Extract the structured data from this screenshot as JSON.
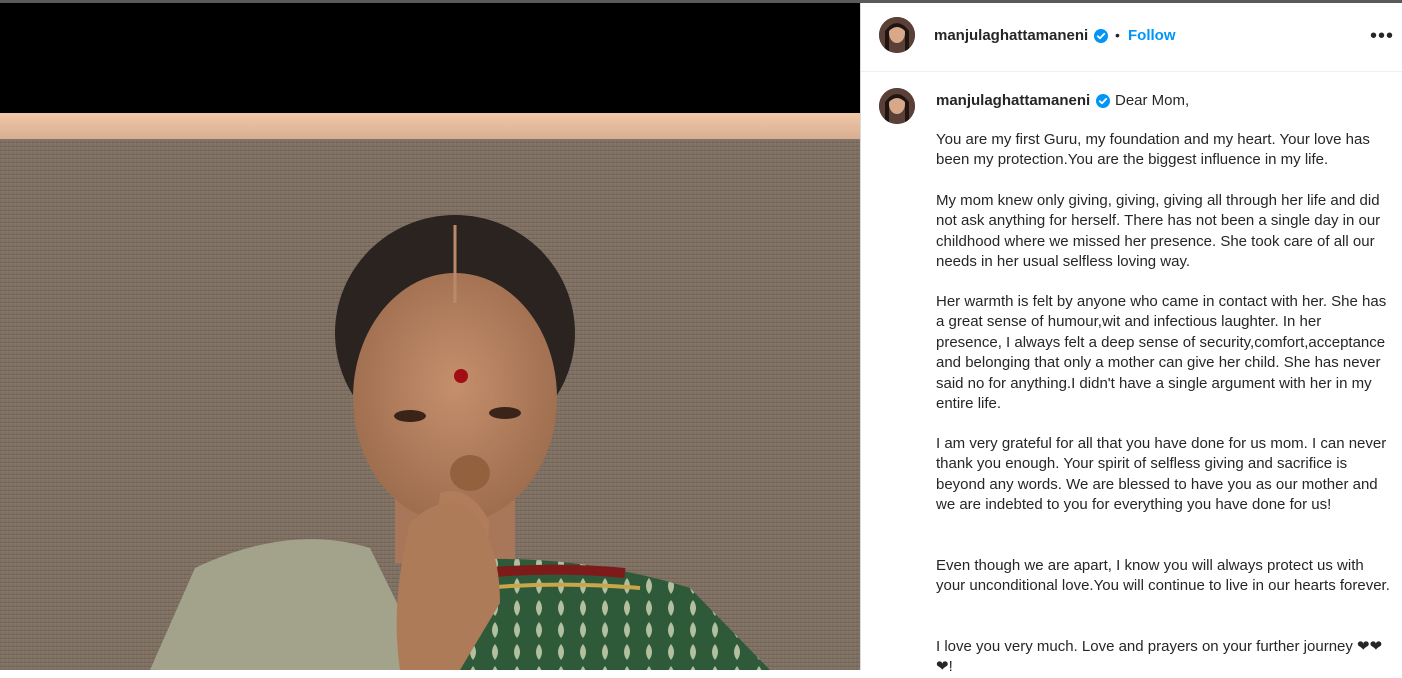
{
  "post": {
    "username": "manjulaghattamaneni",
    "verified": true,
    "separator": "•",
    "follow_label": "Follow",
    "more_label": "•••",
    "avatar_icon": "profile-avatar-icon"
  },
  "caption": {
    "username": "manjulaghattamaneni",
    "greeting": "Dear Mom,",
    "paragraphs": [
      "You are my first Guru, my foundation and my heart. Your love has been my protection.You are the biggest influence in my life.",
      "My mom knew only giving, giving, giving all through her life and did not ask anything for herself. There has not been a single day in our childhood where we missed her presence. She took care of all our needs in her usual selfless loving way.",
      "Her warmth is felt by anyone who came in contact with her. She has a great sense of humour,wit and infectious laughter. In her presence, I always felt a deep sense of security,comfort,acceptance and belonging that only a mother can give her child. She has never said no for anything.I didn't have a single argument with her in my entire life.",
      "I am very grateful for all that you have done for us mom. I can never thank you enough. Your spirit of selfless giving and sacrifice is beyond any words. We are blessed to have you as our mother and we are indebted to you for everything you have done for us!",
      "Even though we are apart, I know you will always protect us with your unconditional love.You will continue to live in our hearts forever.",
      "I love you very much. Love and prayers on your further journey ❤❤❤!"
    ]
  },
  "colors": {
    "link_blue": "#0095f6",
    "verified_blue": "#0095f6",
    "text": "#262626"
  }
}
